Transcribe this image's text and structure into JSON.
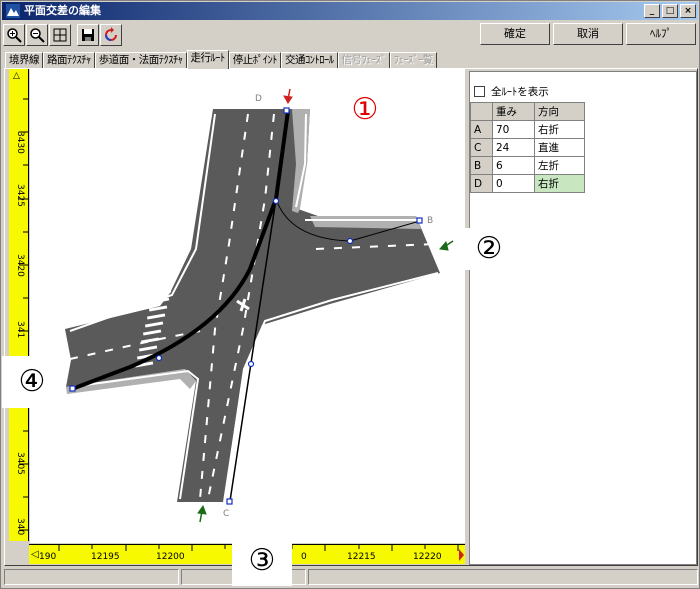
{
  "window": {
    "title": "平面交差の編集",
    "controls": [
      "_",
      "□",
      "×"
    ]
  },
  "toolbar": {
    "icons": [
      "zoom-in-icon",
      "zoom-out-icon",
      "fit-icon",
      "save-icon",
      "refresh-icon"
    ]
  },
  "commands": {
    "ok": "確定",
    "cancel": "取消",
    "help": "ﾍﾙﾌﾟ"
  },
  "tabs": [
    {
      "label": "境界線",
      "state": "normal"
    },
    {
      "label": "路面ﾃｸｽﾁｬ",
      "state": "normal"
    },
    {
      "label": "歩道面・法面ﾃｸｽﾁｬ",
      "state": "normal"
    },
    {
      "label": "走行ﾙｰﾄ",
      "state": "active"
    },
    {
      "label": "停止ﾎﾟｲﾝﾄ",
      "state": "normal"
    },
    {
      "label": "交通ｺﾝﾄﾛｰﾙ",
      "state": "normal"
    },
    {
      "label": "信号ﾌｪｰｽﾞ",
      "state": "disabled"
    },
    {
      "label": "ﾌｪｰｽﾞｰ覧",
      "state": "disabled"
    }
  ],
  "ruler_left": {
    "ticks": [
      "3430",
      "3425",
      "3420",
      "341",
      "3405",
      "340"
    ],
    "marker": "△"
  },
  "ruler_bottom": {
    "ticks": [
      "190",
      "12195",
      "12200",
      "0",
      "12215",
      "12220"
    ],
    "marker": "◁"
  },
  "canvas": {
    "labels": {
      "d": "D",
      "b": "B",
      "c": "C"
    },
    "approach_labels": [
      "①",
      "②",
      "③",
      "④"
    ]
  },
  "side": {
    "show_all": "全ﾙｰﾄを表示",
    "columns": [
      "重み",
      "方向"
    ],
    "rows": [
      {
        "id": "A",
        "weight": "70",
        "dir": "右折"
      },
      {
        "id": "C",
        "weight": "24",
        "dir": "直進"
      },
      {
        "id": "B",
        "weight": "6",
        "dir": "左折"
      },
      {
        "id": "D",
        "weight": "0",
        "dir": "右折"
      }
    ]
  },
  "colors": {
    "title_start": "#0a246a",
    "title_end": "#a6caf0",
    "ruler": "#f6f900",
    "selected_cell": "#c8e6c0",
    "road": "#5a5a5a",
    "label_red": "#e00000",
    "arrow_green": "#1a6a1a"
  }
}
